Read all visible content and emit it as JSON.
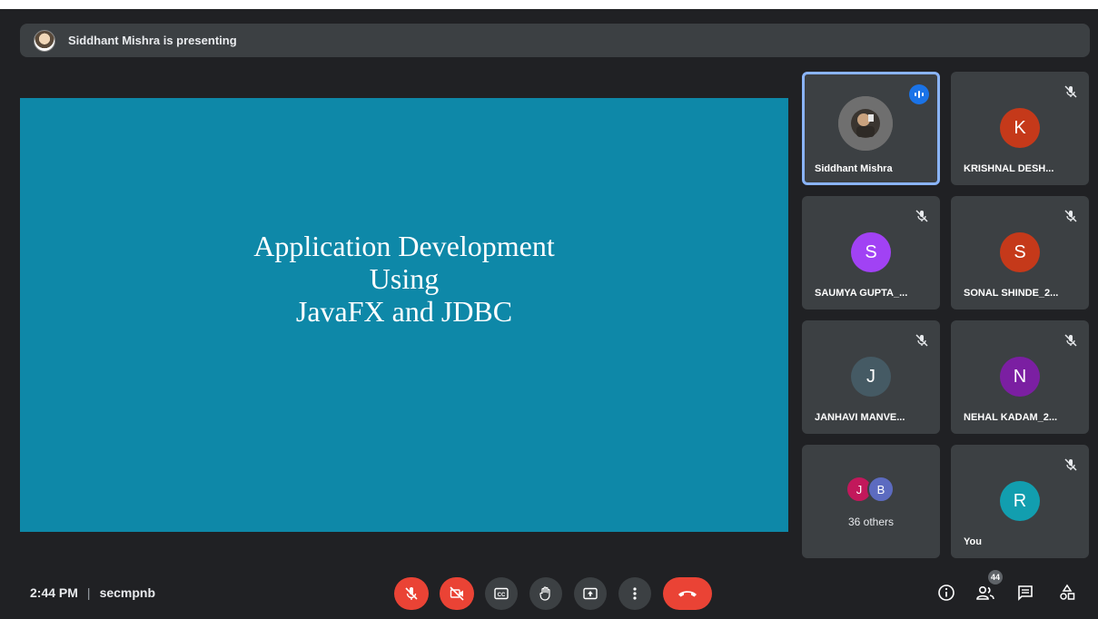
{
  "presenting": {
    "text": "Siddhant Mishra is presenting"
  },
  "slide": {
    "lines": [
      "Application Development",
      "Using",
      "JavaFX and JDBC"
    ]
  },
  "tiles": [
    {
      "name": "Siddhant Mishra",
      "initial": "",
      "color": "#6b6b6b",
      "speaking": true,
      "muted": false
    },
    {
      "name": "KRISHNAL DESH...",
      "initial": "K",
      "color": "#c5391a",
      "muted": true
    },
    {
      "name": "SAUMYA GUPTA_...",
      "initial": "S",
      "color": "#a142f4",
      "muted": true
    },
    {
      "name": "SONAL SHINDE_2...",
      "initial": "S",
      "color": "#c5391a",
      "muted": true
    },
    {
      "name": "JANHAVI MANVE...",
      "initial": "J",
      "color": "#455a64",
      "muted": true
    },
    {
      "name": "NEHAL KADAM_2...",
      "initial": "N",
      "color": "#7b1fa2",
      "muted": true
    },
    {
      "name": "You",
      "initial": "R",
      "color": "#129eaf",
      "muted": true
    }
  ],
  "others": {
    "label": "36 others",
    "avatars": [
      {
        "initial": "J",
        "color": "#c2185b"
      },
      {
        "initial": "B",
        "color": "#5c6bc0"
      }
    ]
  },
  "meeting": {
    "time": "2:44 PM",
    "separator": "|",
    "code": "secmpnb"
  },
  "controls": [
    {
      "icon": "mic-off-icon",
      "label": "Turn on microphone"
    },
    {
      "icon": "camera-off-icon",
      "label": "Turn on camera"
    },
    {
      "icon": "captions-icon",
      "label": "Turn on captions"
    },
    {
      "icon": "raise-hand-icon",
      "label": "Raise hand"
    },
    {
      "icon": "present-icon",
      "label": "Present now"
    },
    {
      "icon": "more-options-icon",
      "label": "More options"
    },
    {
      "icon": "leave-call-icon",
      "label": "Leave call"
    }
  ],
  "people": {
    "count": "44"
  },
  "colors": {
    "background": "#202124",
    "tile": "#3c4043",
    "slide": "#0e88a8",
    "danger": "#ea4335",
    "accent": "#8ab4f8"
  }
}
